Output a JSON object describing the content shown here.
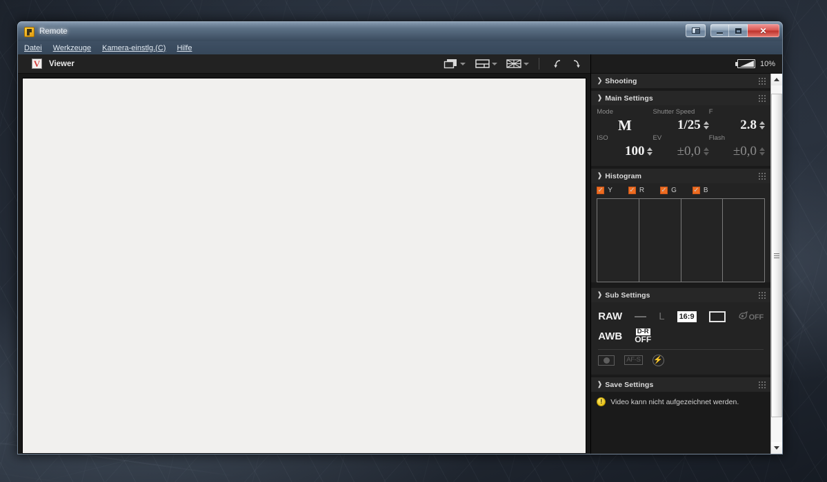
{
  "window": {
    "title": "Remote",
    "icon": "app-icon",
    "caption": {
      "restore_label": "❐",
      "minimize_label": "–",
      "maximize_label": "□",
      "close_label": "✕"
    }
  },
  "menubar": {
    "items": [
      {
        "label": "Datei"
      },
      {
        "label": "Werkzeuge"
      },
      {
        "label": "Kamera-einstlg.(C)"
      },
      {
        "label": "Hilfe"
      }
    ]
  },
  "viewer": {
    "logo_letter": "V",
    "title": "Viewer",
    "tools": [
      {
        "name": "display-mode-icon",
        "caret": true
      },
      {
        "name": "layout-mode-icon",
        "caret": true
      },
      {
        "name": "grid-overlay-icon",
        "caret": true
      }
    ],
    "rotate_left": "rotate-left-icon",
    "rotate_right": "rotate-right-icon"
  },
  "panel": {
    "battery": {
      "percent": "10%",
      "level": 10
    },
    "sections": {
      "shooting": {
        "title": "Shooting",
        "collapsed": true
      },
      "main_settings": {
        "title": "Main Settings",
        "collapsed": false,
        "fields": [
          {
            "label": "Mode",
            "value": "M",
            "spinner": false,
            "dim": false
          },
          {
            "label": "Shutter Speed",
            "value": "1/25",
            "spinner": true,
            "dim": false
          },
          {
            "label": "F",
            "value": "2.8",
            "spinner": true,
            "dim": false
          },
          {
            "label": "ISO",
            "value": "100",
            "spinner": true,
            "dim": false
          },
          {
            "label": "EV",
            "value": "±0,0",
            "spinner": true,
            "dim": true
          },
          {
            "label": "Flash",
            "value": "±0,0",
            "spinner": true,
            "dim": true
          }
        ]
      },
      "histogram": {
        "title": "Histogram",
        "collapsed": false,
        "channels": [
          {
            "label": "Y",
            "checked": true
          },
          {
            "label": "R",
            "checked": true
          },
          {
            "label": "G",
            "checked": true
          },
          {
            "label": "B",
            "checked": true
          }
        ],
        "check_color": "#ee6c20",
        "divisions": 4
      },
      "sub_settings": {
        "title": "Sub Settings",
        "collapsed": false,
        "row1": [
          {
            "name": "quality-raw",
            "text": "RAW",
            "style": "bold"
          },
          {
            "name": "quality-dash",
            "text": "—",
            "style": "dash"
          },
          {
            "name": "picture-size",
            "text": "L",
            "style": "dim"
          },
          {
            "name": "aspect-ratio",
            "text": "16:9",
            "style": "inverted"
          },
          {
            "name": "frame-icon",
            "text": "",
            "style": "rect"
          },
          {
            "name": "creative-off",
            "text": "OFF",
            "style": "off"
          }
        ],
        "row2": [
          {
            "name": "white-balance",
            "text": "AWB",
            "style": "bold"
          },
          {
            "name": "dynamic-range",
            "text_top": "D-R",
            "text_bottom": "OFF",
            "style": "stacked"
          }
        ],
        "row3": [
          {
            "name": "metering-mode-icon"
          },
          {
            "name": "focus-mode-afs",
            "text": "AF-S"
          },
          {
            "name": "flash-off-icon"
          }
        ]
      },
      "save_settings": {
        "title": "Save Settings",
        "collapsed": false
      }
    },
    "status": {
      "icon": "warning-icon",
      "icon_glyph": "!",
      "message": "Video kann nicht aufgezeichnet werden."
    }
  }
}
